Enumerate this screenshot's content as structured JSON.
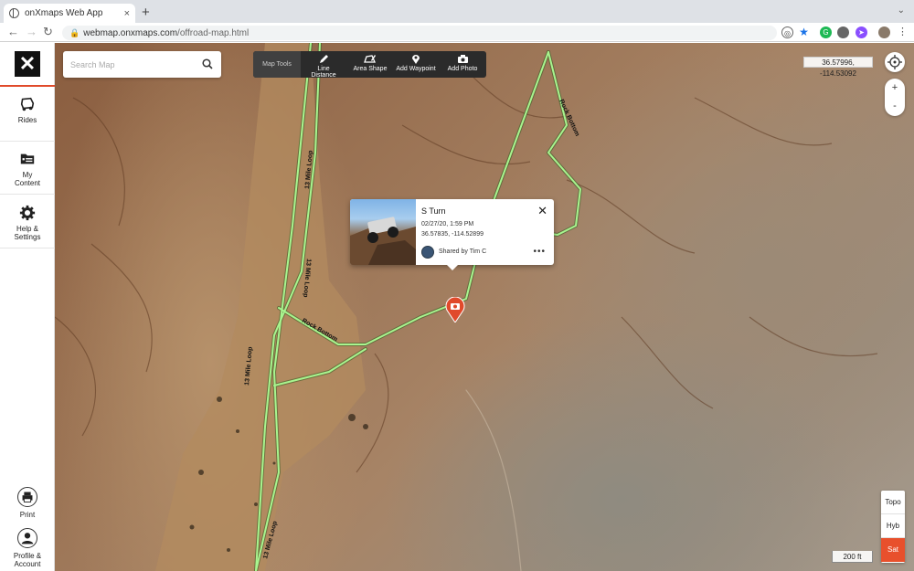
{
  "browser": {
    "tab_title": "onXmaps Web App",
    "tab_close": "×",
    "new_tab": "+",
    "url_host": "webmap.onxmaps.com",
    "url_path": "/offroad-map.html"
  },
  "sidebar": {
    "rides": "Rides",
    "my_content_1": "My",
    "my_content_2": "Content",
    "help_1": "Help &",
    "help_2": "Settings",
    "print": "Print",
    "profile_1": "Profile &",
    "profile_2": "Account"
  },
  "search": {
    "placeholder": "Search Map"
  },
  "tools": {
    "label": "Map Tools",
    "line_distance": "Line Distance",
    "area_shape": "Area Shape",
    "add_waypoint": "Add Waypoint",
    "add_photo": "Add Photo"
  },
  "coords_readout": "36.57996, -114.53092",
  "zoom": {
    "in": "+",
    "out": "-"
  },
  "popup": {
    "title": "S Turn",
    "date": "02/27/20, 1:59 PM",
    "coords": "36.57835, -114.52899",
    "shared_by": "Shared by Tim C",
    "close": "✕",
    "more": "•••"
  },
  "trails": {
    "mile_loop": "13 Mile Loop",
    "rock_bottom": "Rock Bottom"
  },
  "scale_text": "200 ft",
  "map_types": {
    "topo": "Topo",
    "hybrid": "Hyb",
    "sat": "Sat",
    "active": "Sat"
  },
  "colors": {
    "accent": "#e8502c",
    "trail": "#9ef08a",
    "marker": "#e04a2b"
  }
}
